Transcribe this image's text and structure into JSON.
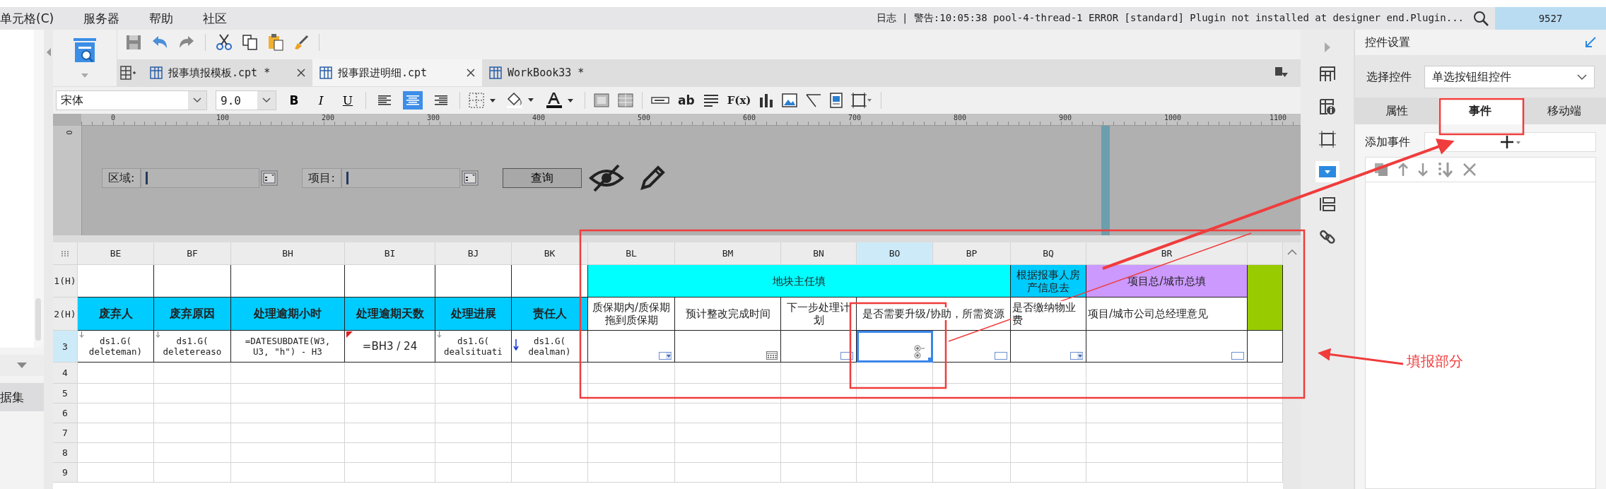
{
  "menu": [
    "单元格(C)",
    "服务器",
    "帮助",
    "社区"
  ],
  "log": "日志 | 警告:10:05:38 pool-4-thread-1 ERROR [standard] Plugin not installed at designer end.Plugin...",
  "user": "9527",
  "left_panel": {
    "item": "据集"
  },
  "file_tabs": [
    {
      "label": "报事填报模板.cpt *",
      "selected": false
    },
    {
      "label": "报事跟进明细.cpt",
      "selected": true
    },
    {
      "label": "WorkBook33 *",
      "selected": false
    }
  ],
  "font": {
    "family": "宋体",
    "size": "9.0"
  },
  "styles": [
    "B",
    "I",
    "U"
  ],
  "alignment": [
    {
      "kind": "left",
      "selected": false
    },
    {
      "kind": "center",
      "selected": true
    },
    {
      "kind": "right",
      "selected": false
    }
  ],
  "text_tools": [
    "ab",
    "F(x)"
  ],
  "ruler": {
    "ticks": [
      "0",
      "100",
      "200",
      "300",
      "400",
      "500",
      "600",
      "700",
      "800",
      "900",
      "1000",
      "1100"
    ],
    "vertical": "0"
  },
  "form": {
    "fields": [
      {
        "label": "区域:"
      },
      {
        "label": "项目:"
      }
    ],
    "query_button": "查询"
  },
  "sheet": {
    "columns": [
      {
        "label": "BE",
        "selected": false
      },
      {
        "label": "BF",
        "selected": false
      },
      {
        "label": "BH",
        "selected": false
      },
      {
        "label": "BI",
        "selected": false
      },
      {
        "label": "BJ",
        "selected": false
      },
      {
        "label": "BK",
        "selected": false
      },
      {
        "label": "BL",
        "selected": false
      },
      {
        "label": "BM",
        "selected": false
      },
      {
        "label": "BN",
        "selected": false
      },
      {
        "label": "BO",
        "selected": true
      },
      {
        "label": "BP",
        "selected": false
      },
      {
        "label": "BQ",
        "selected": false
      },
      {
        "label": "BR",
        "selected": false
      }
    ],
    "rows": [
      {
        "header": "1(H)",
        "selected": false,
        "cells": [
          {},
          {},
          {},
          {},
          {},
          {},
          {
            "text": "地块主任填",
            "color": "#00ffff"
          },
          {
            "text": "根据报事人房产信息去",
            "color": "#00ccff"
          },
          {
            "text": "项目总/城市总填",
            "color": "#cc99ff"
          },
          {
            "color": "#99cc00"
          }
        ]
      },
      {
        "header": "2(H)",
        "selected": false,
        "cells": [
          {
            "text": "废弃人",
            "color": "#00ccff",
            "kind": "title"
          },
          {
            "text": "废弃原因",
            "color": "#00ccff",
            "kind": "title"
          },
          {
            "text": "处理逾期小时",
            "color": "#00ccff",
            "kind": "title"
          },
          {
            "text": "处理逾期天数",
            "color": "#00ccff",
            "kind": "title"
          },
          {
            "text": "处理进展",
            "color": "#00ccff",
            "kind": "title"
          },
          {
            "text": "责任人",
            "color": "#00ccff",
            "kind": "title"
          },
          {
            "text": "质保期内/质保期拖到质保期"
          },
          {
            "text": "预计整改完成时间"
          },
          {
            "text": "下一步处理计划"
          },
          {
            "text": "是否需要升级/协助，所需资源",
            "kind": "right"
          },
          {
            "text": "是否缴纳物业费",
            "kind": "left"
          },
          {
            "text": "项目/城市公司总经理意见",
            "kind": "left"
          }
        ]
      },
      {
        "header": "3",
        "selected": true,
        "cells": [
          {
            "text": "ds1.G(\ndeleteman)",
            "kind": "expand"
          },
          {
            "text": "ds1.G(\ndeletereaso",
            "kind": "expand"
          },
          {
            "text": "=DATESUBDATE(W3,\nU3, \"h\") - H3"
          },
          {
            "text": "=BH3 / 24",
            "kind": "comment"
          },
          {
            "text": "ds1.G(\ndealsituati",
            "kind": "expand"
          },
          {
            "text": "ds1.G(\ndealman)",
            "kind": "expand_down"
          },
          {
            "kind": "dropdown"
          },
          {
            "kind": "date"
          },
          {
            "kind": "textbox"
          },
          {
            "kind": "radio"
          },
          {
            "kind": "textbox"
          },
          {
            "kind": "dropdown"
          },
          {
            "kind": "textbox"
          },
          {}
        ]
      },
      {
        "header": "4",
        "selected": false
      },
      {
        "header": "5",
        "selected": false
      },
      {
        "header": "6",
        "selected": false
      },
      {
        "header": "7",
        "selected": false
      },
      {
        "header": "8",
        "selected": false
      },
      {
        "header": "9",
        "selected": false
      }
    ]
  },
  "side_icons": [
    {
      "kind": "grid",
      "selected": false
    },
    {
      "kind": "info",
      "selected": false
    },
    {
      "kind": "frame",
      "selected": false
    },
    {
      "kind": "widget",
      "selected": true
    },
    {
      "kind": "stack",
      "selected": false
    },
    {
      "kind": "link",
      "selected": false
    }
  ],
  "panel": {
    "title": "控件设置",
    "select_label": "选择控件",
    "select_value": "单选按钮组控件",
    "tabs": [
      {
        "label": "属性",
        "selected": false
      },
      {
        "label": "事件",
        "selected": true
      },
      {
        "label": "移动端",
        "selected": false
      }
    ],
    "add_event_label": "添加事件"
  },
  "annotation": {
    "label": "填报部分"
  }
}
